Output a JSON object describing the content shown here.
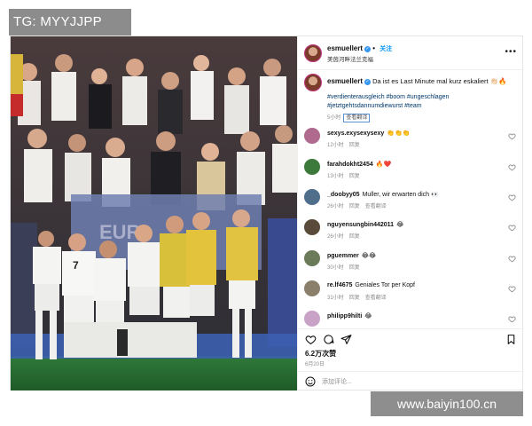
{
  "watermarks": {
    "top_left": "TG: MYYJJPP",
    "bottom_right": "www.baiyin100.cn"
  },
  "photo": {
    "banner_text": "EUR",
    "jersey_number": "7"
  },
  "post": {
    "author": {
      "username": "esmuellert",
      "verified": true,
      "follow_label": "关注",
      "subtitle": "美茵河畔法兰克福"
    },
    "caption": {
      "username": "esmuellert",
      "text": "Da ist es Last Minute mal kurz eskaliert",
      "emojis": "👏🏻🔥",
      "hashtags": "#verdienterausgleich #boom #ungeschlagen #jetztgehtsdannumdiewurst #team",
      "age": "5小时",
      "translate_label": "查看翻译"
    },
    "comments": [
      {
        "username": "sexys.exysexysexy",
        "text": "👏👏👏",
        "age": "12小时",
        "reply_label": "回复",
        "avatar_color": "#b06a8d"
      },
      {
        "username": "farahdokht2454",
        "text": "🔥❤️",
        "age": "13小时",
        "reply_label": "回复",
        "avatar_color": "#3c7a3c"
      },
      {
        "username": "_doobyy05",
        "text": "Muller, wir erwarten dich 👀",
        "age": "26小时",
        "reply_label": "回复",
        "translate_label": "查看翻译",
        "avatar_color": "#4e6e8c"
      },
      {
        "username": "nguyensungbin442011",
        "text": "😂",
        "age": "26小时",
        "reply_label": "回复",
        "avatar_color": "#5a4a3a"
      },
      {
        "username": "pguemmer",
        "text": "😂😂",
        "age": "30小时",
        "reply_label": "回复",
        "avatar_color": "#6b7a58"
      },
      {
        "username": "re.lf4675",
        "text": "Geniales Tor per Kopf",
        "age": "31小时",
        "reply_label": "回复",
        "translate_label": "查看翻译",
        "avatar_color": "#8a7f6a"
      },
      {
        "username": "philipp9hilti",
        "text": "😂",
        "age": "",
        "reply_label": "",
        "avatar_color": "#c9a2c8"
      }
    ],
    "likes": "6.2万次赞",
    "date": "6月20日",
    "add_comment_placeholder": "添加评论..."
  },
  "colors": {
    "accent_blue": "#0095f6",
    "hashtag_blue": "#00376b",
    "meta_gray": "#8e8e8e",
    "story_ring": "#c13584"
  }
}
